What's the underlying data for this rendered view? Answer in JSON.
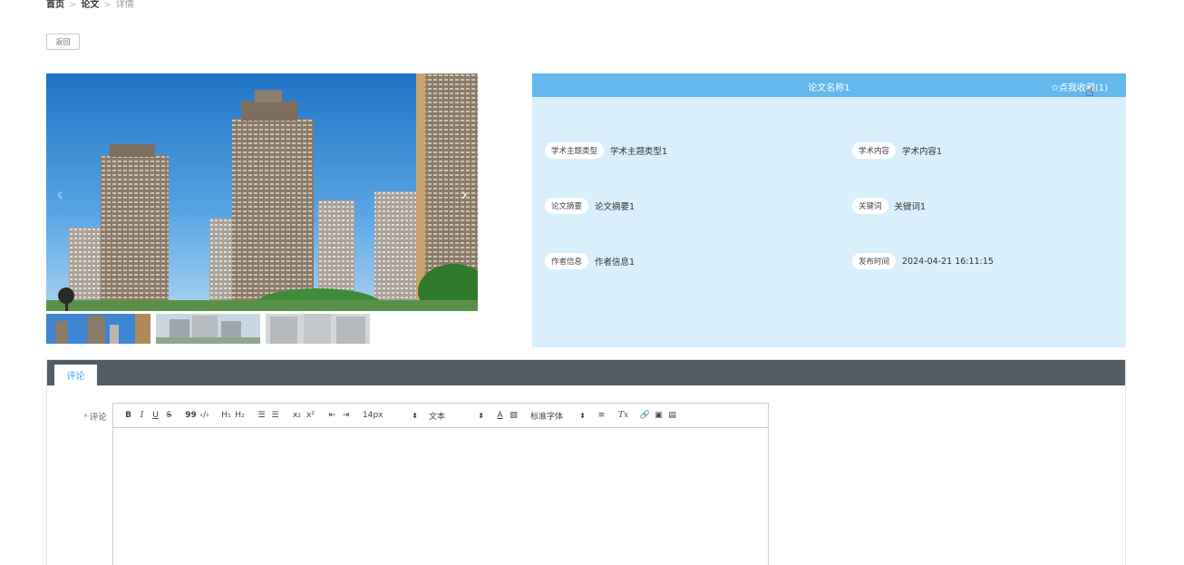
{
  "breadcrumb": {
    "home": "首页",
    "section": "论文",
    "current": "详情",
    "separator": ">"
  },
  "back_button": "返回",
  "carousel": {
    "prev": "‹",
    "next": "›"
  },
  "detail": {
    "title": "论文名称1",
    "favorite": "✩点我收藏(1)",
    "fields": {
      "theme_type_label": "学术主题类型",
      "theme_type_value": "学术主题类型1",
      "content_label": "学术内容",
      "content_value": "学术内容1",
      "abstract_label": "论文摘要",
      "abstract_value": "论文摘要1",
      "keywords_label": "关键词",
      "keywords_value": "关键词1",
      "author_label": "作者信息",
      "author_value": "作者信息1",
      "publish_label": "发布时间",
      "publish_value": "2024-04-21 16:11:15"
    }
  },
  "comment": {
    "tab": "评论",
    "required_mark": "*",
    "label": "评论",
    "toolbar": {
      "bold": "B",
      "italic": "I",
      "underline": "U",
      "strike": "S",
      "blockquote": "99",
      "code": "‹/›",
      "h1": "H₁",
      "h2": "H₂",
      "ordered_list": "☰",
      "bullet_list": "☰",
      "subscript": "x₂",
      "superscript": "x²",
      "outdent": "⇤",
      "indent": "⇥",
      "size": "14px",
      "header": "文本",
      "font_color": "A",
      "bg_color": "▧",
      "font": "标准字体",
      "align": "≡",
      "clean": "Tx",
      "link": "🔗",
      "image": "▣",
      "video": "▤",
      "dropdown": "⬍"
    }
  },
  "colors": {
    "header_blue": "#63b8ee",
    "panel_bg": "#d9f0fc",
    "tab_bar": "#545c64",
    "accent": "#409eff"
  }
}
